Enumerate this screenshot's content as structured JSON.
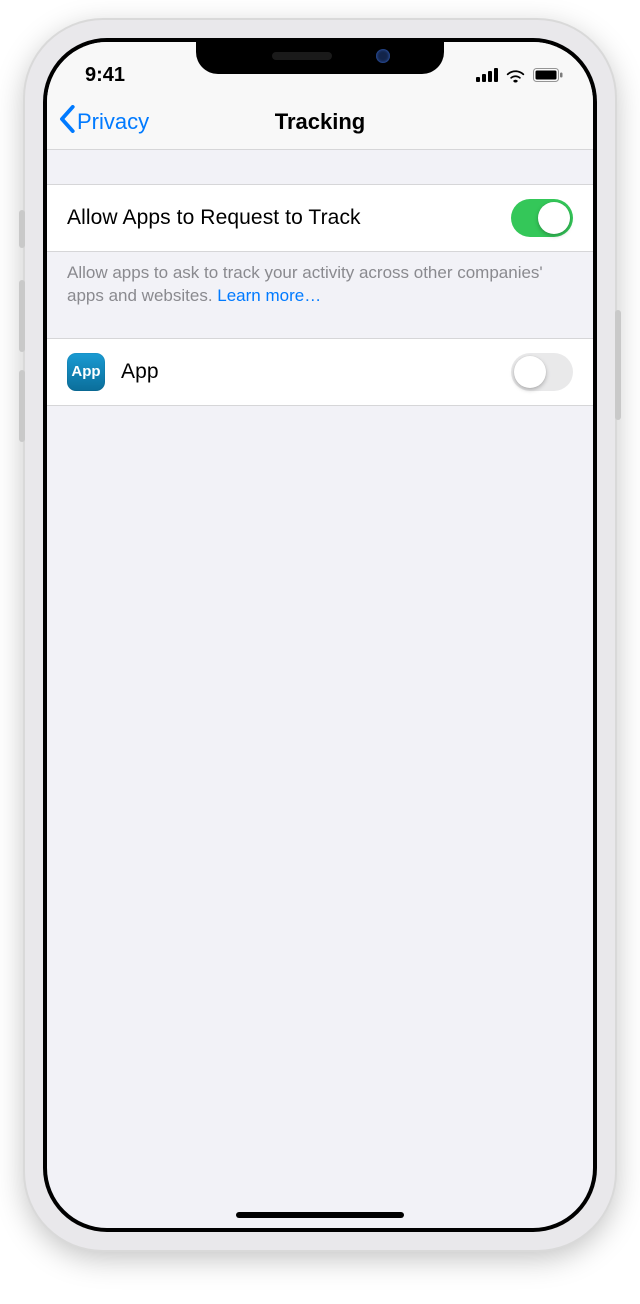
{
  "status": {
    "time": "9:41"
  },
  "nav": {
    "back_label": "Privacy",
    "title": "Tracking"
  },
  "settings": {
    "allow_row": {
      "label": "Allow Apps to Request to Track",
      "enabled": true
    },
    "description": "Allow apps to ask to track your activity across other companies' apps and websites. ",
    "learn_more": "Learn more…"
  },
  "apps": [
    {
      "icon_label": "App",
      "name": "App",
      "enabled": false
    }
  ]
}
